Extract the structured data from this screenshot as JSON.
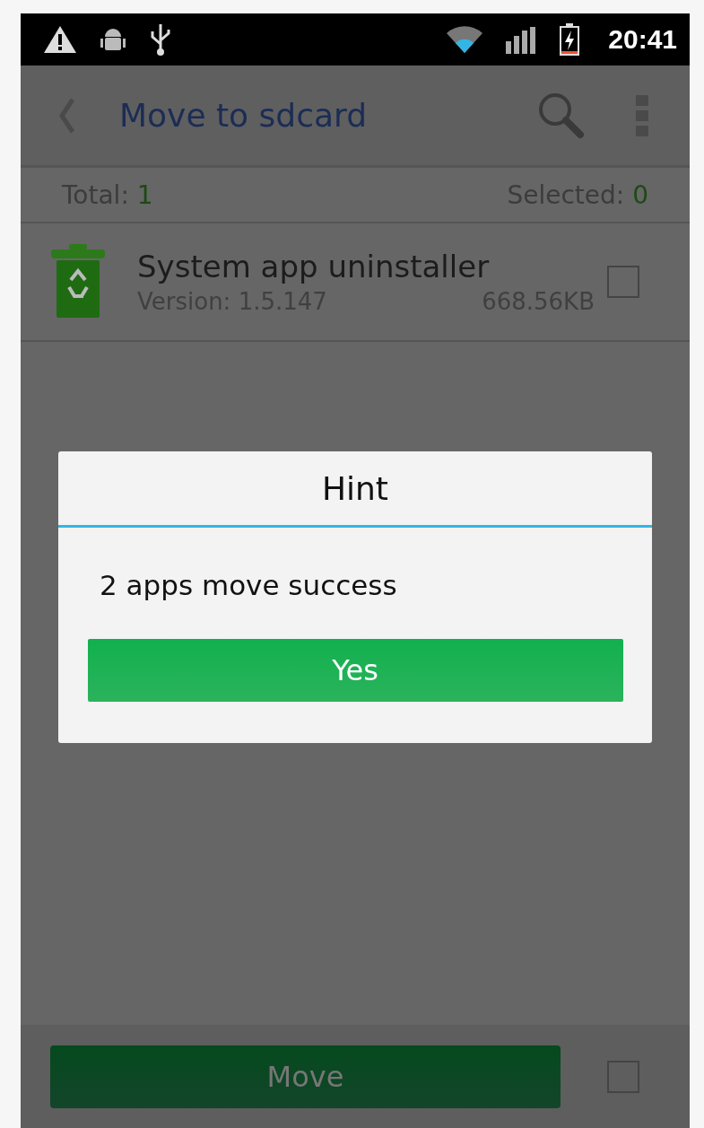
{
  "status_bar": {
    "time": "20:41"
  },
  "app_bar": {
    "title": "Move to sdcard"
  },
  "counts": {
    "total_label": "Total: ",
    "total": "1",
    "selected_label": "Selected: ",
    "selected": "0"
  },
  "apps": [
    {
      "name": "System app uninstaller",
      "version": "Version: 1.5.147",
      "size": "668.56KB",
      "checked": false
    }
  ],
  "dialog": {
    "title": "Hint",
    "message": "2 apps move success",
    "button": "Yes"
  },
  "bottom_bar": {
    "button": "Move",
    "select_all_checked": false
  }
}
